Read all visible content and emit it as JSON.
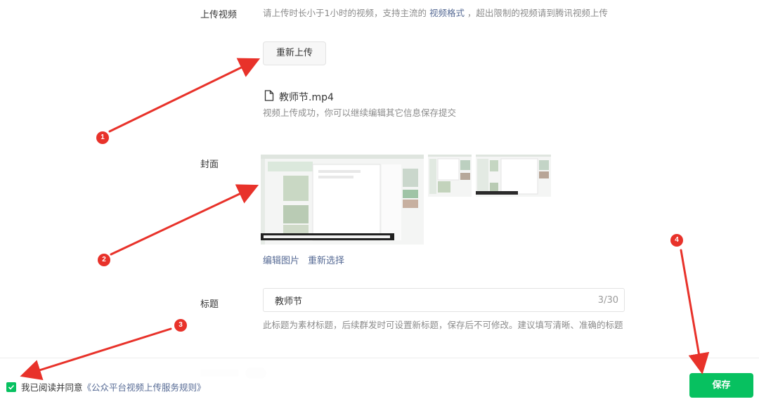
{
  "upload": {
    "label": "上传视频",
    "desc_before": "请上传时长小于1小时的视频，支持主流的 ",
    "desc_link": "视频格式",
    "desc_after": " ，超出限制的视频请到腾讯视频上传",
    "reupload_button": "重新上传",
    "file_name": "教师节.mp4",
    "file_icon": "document-icon",
    "success_text": "视频上传成功，你可以继续编辑其它信息保存提交"
  },
  "cover": {
    "label": "封面",
    "edit_image": "编辑图片",
    "reselect": "重新选择"
  },
  "title": {
    "label": "标题",
    "value": "教师节",
    "count": "3/30",
    "hint": "此标题为素材标题，后续群发时可设置新标题，保存后不可修改。建议填写清晰、准确的标题"
  },
  "footer": {
    "agree_prefix": "我已阅读并同意",
    "agree_link": "《公众平台视频上传服务规则》",
    "checkbox_icon": "check-icon",
    "save_button": "保存"
  },
  "annotations": [
    "1",
    "2",
    "3",
    "4"
  ],
  "colors": {
    "accent_green": "#07c160",
    "link_blue": "#576b95",
    "annotation_red": "#e8322a"
  }
}
